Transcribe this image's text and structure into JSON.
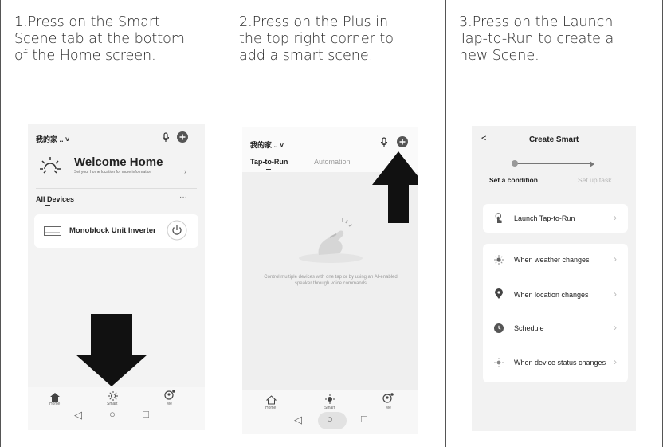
{
  "steps": [
    {
      "text": "1.Press on the Smart\nScene tab at the bottom\nof the Home screen."
    },
    {
      "text": "2.Press on the Plus in\nthe top right corner to\nadd a smart scene."
    },
    {
      "text": "3.Press on the Launch\nTap-to-Run to create a\nnew Scene."
    }
  ],
  "screen1": {
    "home_name": "我的家 .. ˅",
    "welcome_title": "Welcome Home",
    "welcome_sub": "Set your home location for more information",
    "all_devices": "All Devices",
    "more": "···",
    "device_name": "Monoblock Unit Inverter",
    "tabs": [
      "Home",
      "Smart",
      "Me"
    ]
  },
  "screen2": {
    "home_name": "我的家 .. ˅",
    "tab_active": "Tap-to-Run",
    "tab_inactive": "Automation",
    "empty_text": "Control multiple devices with one tap or by using an AI-enabled speaker through voice commands",
    "tabs": [
      "Home",
      "Smart",
      "Me"
    ]
  },
  "screen3": {
    "back": "<",
    "title": "Create Smart",
    "set_condition": "Set a condition",
    "set_task": "Set up task",
    "launch": "Launch Tap-to-Run",
    "rows": [
      "When weather changes",
      "When location changes",
      "Schedule",
      "When device status changes"
    ]
  },
  "nav": {
    "back": "◁",
    "home": "○",
    "recents": "□"
  }
}
